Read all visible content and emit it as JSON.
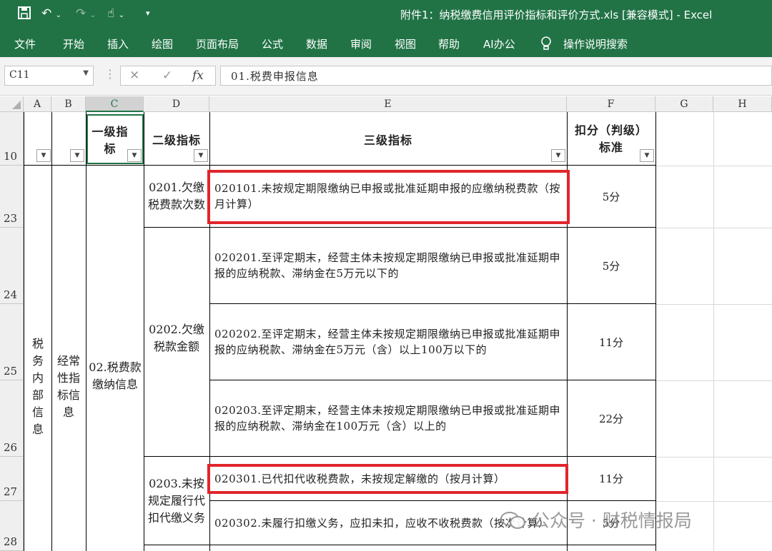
{
  "window": {
    "title": "附件1：纳税缴费信用评价指标和评价方式.xls [兼容模式] - Excel"
  },
  "qat": {
    "save_icon": "save-icon",
    "undo_icon": "undo-icon",
    "redo_icon": "redo-icon",
    "touch_icon": "touch-mode-icon",
    "customize_icon": "customize-qat-icon"
  },
  "menu": {
    "items": [
      "文件",
      "开始",
      "插入",
      "绘图",
      "页面布局",
      "公式",
      "数据",
      "审阅",
      "视图",
      "帮助",
      "AI办公"
    ],
    "search_label": "操作说明搜索",
    "search_icon": "lightbulb-icon"
  },
  "formula_bar": {
    "name_box": "C11",
    "cancel": "✕",
    "confirm": "✓",
    "fx": "fx",
    "value": "01.税费申报信息"
  },
  "columns": [
    "A",
    "B",
    "C",
    "D",
    "E",
    "F",
    "G",
    "H"
  ],
  "rows": [
    "10",
    "23",
    "24",
    "25",
    "26",
    "27",
    "28"
  ],
  "header_row": {
    "c": "一级指标",
    "d": "二级指标",
    "e": "三级指标",
    "f": "扣分（判级）标准",
    "filter_icon": "filter-dropdown-icon"
  },
  "cells": {
    "a_merged": "税务内部信息",
    "b_merged": "经常性指标信息",
    "c_merged": "02.税费款缴纳信息",
    "d23": "0201.欠缴税费款次数",
    "d24": "0202.欠缴税款金额",
    "d27": "0203.未按规定履行代扣代缴义务",
    "e23": "020101.未按规定期限缴纳已申报或批准延期申报的应缴纳税费款（按月计算）",
    "e24": "020201.至评定期末，经营主体未按规定期限缴纳已申报或批准延期申报的应纳税款、滞纳金在5万元以下的",
    "e25": "020202.至评定期末，经营主体未按规定期限缴纳已申报或批准延期申报的应纳税款、滞纳金在5万元（含）以上100万以下的",
    "e26": "020203.至评定期末，经营主体未按规定期限缴纳已申报或批准延期申报的应纳税款、滞纳金在100万元（含）以上的",
    "e27": "020301.已代扣代收税费款，未按规定解缴的（按月计算）",
    "e28": "020302.未履行扣缴义务，应扣未扣，应收不收税费款（按次计算）",
    "f23": "5分",
    "f24": "5分",
    "f25": "11分",
    "f26": "22分",
    "f27": "11分",
    "f28": "5分"
  },
  "watermark": "公众号 · 财税情报局",
  "colors": {
    "excel_green": "#217346",
    "highlight_red": "#e0262c"
  }
}
